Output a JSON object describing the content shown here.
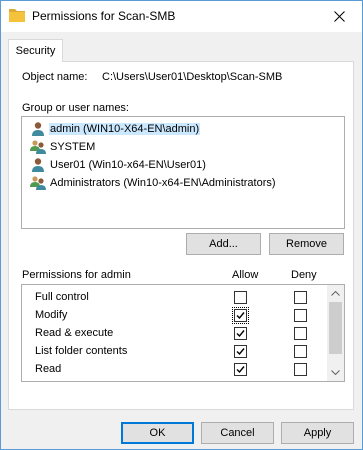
{
  "window": {
    "title": "Permissions for Scan-SMB"
  },
  "tabs": [
    {
      "label": "Security"
    }
  ],
  "object": {
    "label": "Object name:",
    "value": "C:\\Users\\User01\\Desktop\\Scan-SMB"
  },
  "groups": {
    "label": "Group or user names:",
    "items": [
      {
        "label": "admin (WIN10-X64-EN\\admin)",
        "icon": "user-icon",
        "selected": true
      },
      {
        "label": "SYSTEM",
        "icon": "group-icon",
        "selected": false
      },
      {
        "label": "User01 (Win10-x64-EN\\User01)",
        "icon": "user-icon",
        "selected": false
      },
      {
        "label": "Administrators (Win10-x64-EN\\Administrators)",
        "icon": "group-icon",
        "selected": false
      }
    ],
    "add_label": "Add...",
    "remove_label": "Remove"
  },
  "permissions": {
    "title": "Permissions for admin",
    "allow_label": "Allow",
    "deny_label": "Deny",
    "rows": [
      {
        "name": "Full control",
        "allow": false,
        "deny": false
      },
      {
        "name": "Modify",
        "allow": true,
        "deny": false
      },
      {
        "name": "Read & execute",
        "allow": true,
        "deny": false
      },
      {
        "name": "List folder contents",
        "allow": true,
        "deny": false
      },
      {
        "name": "Read",
        "allow": true,
        "deny": false
      },
      {
        "name": "",
        "allow": true,
        "deny": false
      }
    ]
  },
  "footer": {
    "ok_label": "OK",
    "cancel_label": "Cancel",
    "apply_label": "Apply"
  },
  "colors": {
    "selection": "#cce8ff",
    "border_accent": "#0078d7",
    "folder": "#f5c33b"
  }
}
